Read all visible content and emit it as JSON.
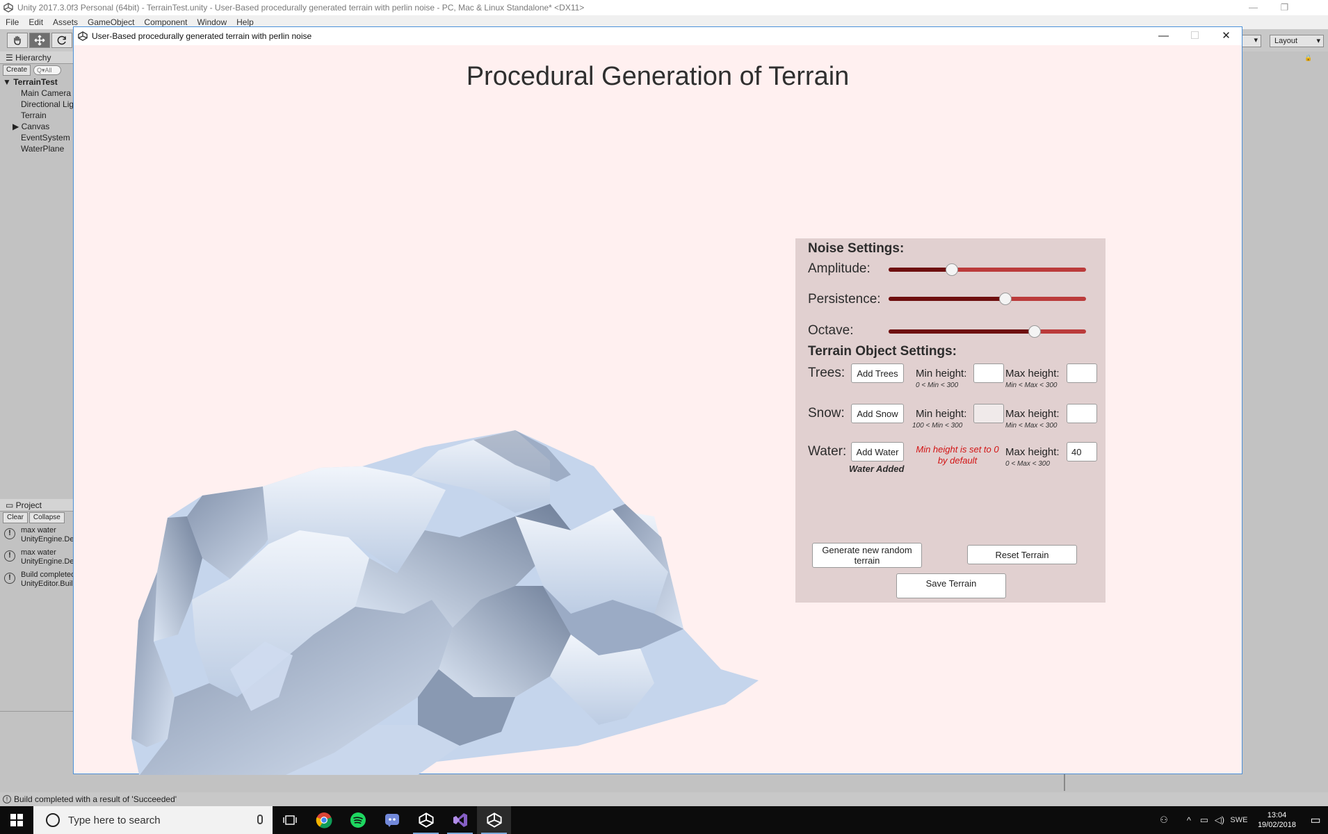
{
  "unity": {
    "window_title": "Unity 2017.3.0f3 Personal (64bit) - TerrainTest.unity - User-Based procedurally generated terrain with perlin noise - PC, Mac & Linux Standalone* <DX11>",
    "menu": [
      "File",
      "Edit",
      "Assets",
      "GameObject",
      "Component",
      "Window",
      "Help"
    ],
    "layout_label": "Layout",
    "hierarchy": {
      "tab": "Hierarchy",
      "create": "Create",
      "search_placeholder": "Q▾All",
      "scene": "TerrainTest",
      "items": [
        "Main Camera",
        "Directional Light",
        "Terrain",
        "Canvas",
        "EventSystem",
        "WaterPlane"
      ]
    },
    "project": {
      "tab": "Project",
      "clear": "Clear",
      "collapse": "Collapse",
      "logs": [
        {
          "line1": "max water",
          "line2": "UnityEngine.Debug"
        },
        {
          "line1": "max water",
          "line2": "UnityEngine.Debug"
        },
        {
          "line1": "Build completed",
          "line2": "UnityEditor.BuildPipeline"
        }
      ]
    },
    "status": "Build completed with a result of 'Succeeded'"
  },
  "taskbar": {
    "search_placeholder": "Type here to search",
    "lang": "SWE",
    "time": "13:04",
    "date": "19/02/2018"
  },
  "game": {
    "window_title": "User-Based procedurally generated terrain with perlin noise",
    "title": "Procedural Generation of Terrain",
    "panel": {
      "noise_header": "Noise Settings:",
      "sliders": [
        {
          "label": "Amplitude:",
          "value": 0.32
        },
        {
          "label": "Persistence:",
          "value": 0.59
        },
        {
          "label": "Octave:",
          "value": 0.74
        }
      ],
      "object_header": "Terrain Object Settings:",
      "trees": {
        "label": "Trees:",
        "button": "Add Trees",
        "min_label": "Min height:",
        "min_value": "",
        "min_hint": "0 < Min < 300",
        "max_label": "Max height:",
        "max_value": "",
        "max_hint": "Min < Max < 300"
      },
      "snow": {
        "label": "Snow:",
        "button": "Add Snow",
        "min_label": "Min height:",
        "min_value": "",
        "min_hint": "100 < Min < 300",
        "max_label": "Max height:",
        "max_value": "",
        "max_hint": "Min < Max < 300"
      },
      "water": {
        "label": "Water:",
        "button": "Add Water",
        "status": "Water Added",
        "note": "Min height is set to 0 by default",
        "max_label": "Max height:",
        "max_value": "40",
        "max_hint": "0 < Max < 300"
      },
      "generate_button": "Generate new random terrain",
      "reset_button": "Reset Terrain",
      "save_button": "Save Terrain"
    }
  }
}
